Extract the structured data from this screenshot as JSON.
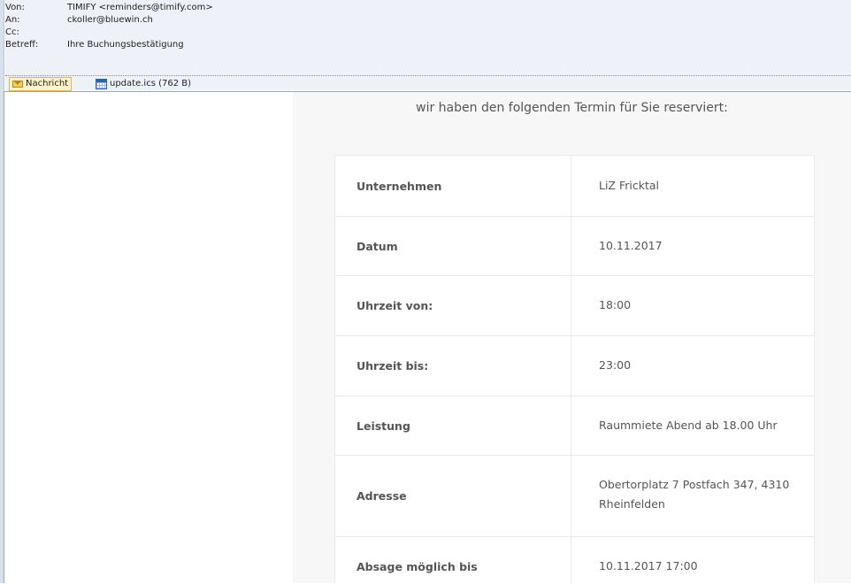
{
  "header": {
    "from_label": "Von:",
    "from_value": "TIMIFY <reminders@timify.com>",
    "to_label": "An:",
    "to_value": "ckoller@bluewin.ch",
    "cc_label": "Cc:",
    "cc_value": "",
    "subject_label": "Betreff:",
    "subject_value": "Ihre Buchungsbestätigung"
  },
  "tabs": [
    {
      "label": "Nachricht",
      "icon": "envelope-icon",
      "active": true
    },
    {
      "label": "update.ics (762 B)",
      "icon": "calendar-icon",
      "active": false
    }
  ],
  "email": {
    "intro": "wir haben den folgenden Termin für Sie reserviert:",
    "rows": [
      {
        "label": "Unternehmen",
        "value": "LiZ Fricktal"
      },
      {
        "label": "Datum",
        "value": "10.11.2017"
      },
      {
        "label": "Uhrzeit von:",
        "value": "18:00"
      },
      {
        "label": "Uhrzeit bis:",
        "value": "23:00"
      },
      {
        "label": "Leistung",
        "value": "Raummiete Abend ab 18.00 Uhr"
      },
      {
        "label": "Adresse",
        "value": "Obertorplatz 7 Postfach 347, 4310 Rheinfelden"
      },
      {
        "label": "Absage möglich bis",
        "value": "10.11.2017 17:00"
      }
    ]
  },
  "colors": {
    "header_bg": "#eef2f8",
    "email_bg": "#f7f7f7",
    "card_bg": "#ffffff",
    "text": "#555555"
  }
}
